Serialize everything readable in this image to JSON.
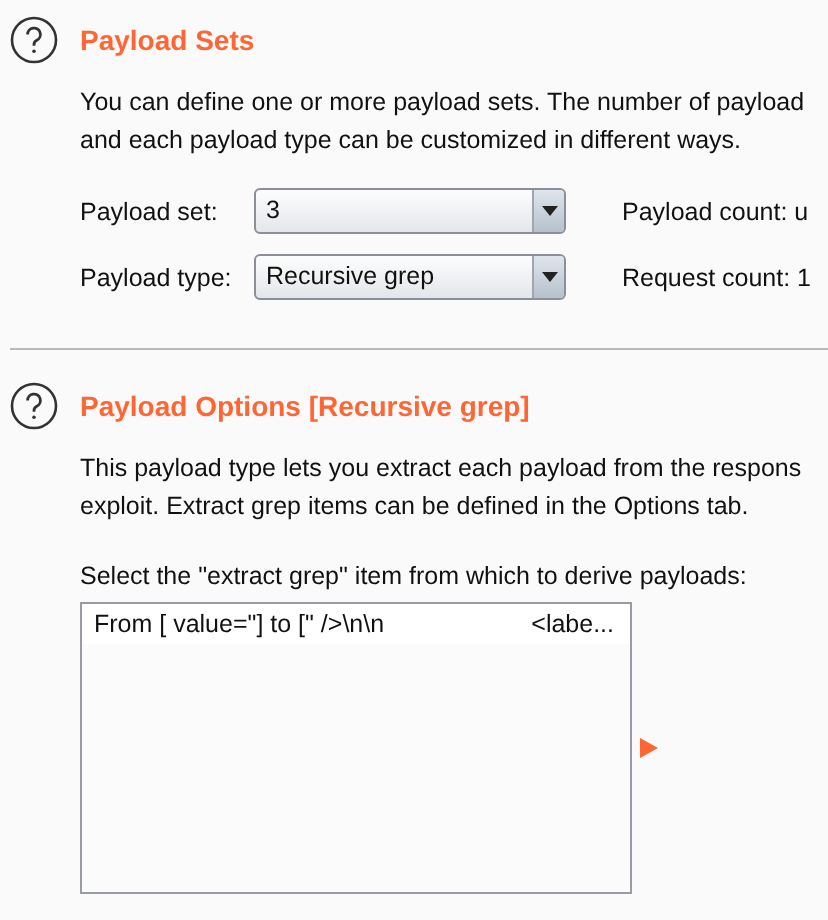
{
  "payload_sets": {
    "title": "Payload Sets",
    "description": [
      "You can define one or more payload sets. The number of payload",
      "and each payload type can be customized in different ways."
    ],
    "fields": [
      {
        "label": "Payload set:",
        "value": "3",
        "info": "Payload count: u"
      },
      {
        "label": "Payload type:",
        "value": "Recursive grep",
        "info": "Request count: 1"
      }
    ]
  },
  "payload_options": {
    "title": "Payload Options [Recursive grep]",
    "description": [
      "This payload type lets you extract each payload from the respons",
      "exploit. Extract grep items can be defined in the Options tab."
    ],
    "prompt": "Select the \"extract grep\" item from which to derive payloads:",
    "items": [
      {
        "from_to": "From [ value=\"] to [\" />\\n\\n",
        "preview": "<labe..."
      }
    ]
  }
}
